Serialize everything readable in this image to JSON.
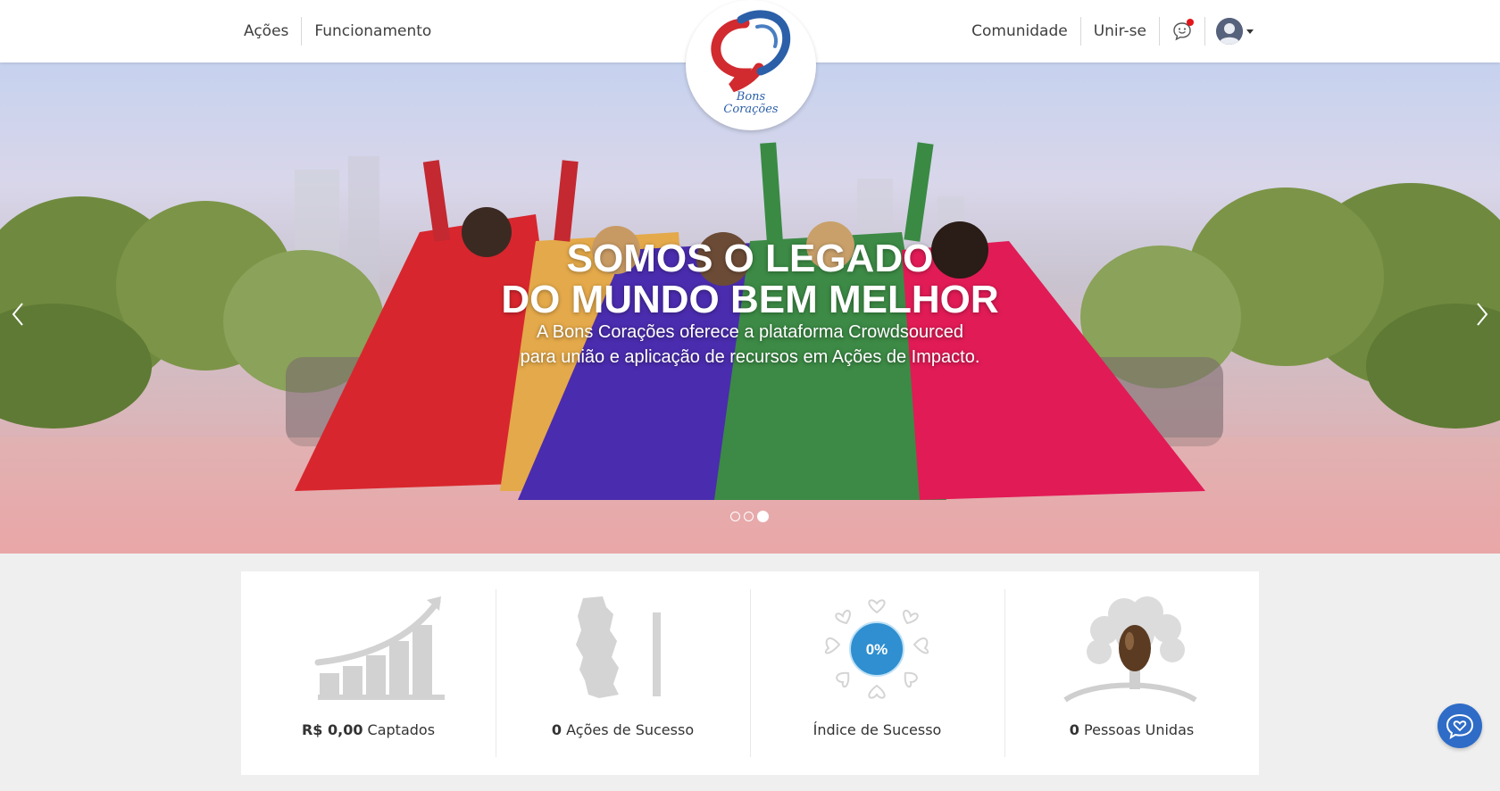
{
  "nav": {
    "left": [
      "Ações",
      "Funcionamento"
    ],
    "right": [
      "Comunidade",
      "Unir-se"
    ]
  },
  "logo": {
    "line1": "Bons",
    "line2": "Corações"
  },
  "hero": {
    "title_line1": "SOMOS O LEGADO",
    "title_line2": "DO MUNDO BEM MELHOR",
    "subtitle_line1": "A Bons Corações oferece a plataforma Crowdsourced",
    "subtitle_line2": "para união e aplicação de recursos em Ações de Impacto.",
    "slides_total": 3,
    "active_slide": 3
  },
  "stats": [
    {
      "value": "R$ 0,00",
      "label": "Captados",
      "icon": "growth-chart-icon"
    },
    {
      "value": "0",
      "label": "Ações de Sucesso",
      "icon": "map-icon"
    },
    {
      "value": "",
      "label": "Índice de Sucesso",
      "badge": "0%",
      "icon": "heart-wreath-icon"
    },
    {
      "value": "0",
      "label": "Pessoas Unidas",
      "icon": "tree-seed-icon"
    }
  ],
  "colors": {
    "accent_blue": "#2e6cc7",
    "logo_red": "#d12a2f",
    "logo_blue": "#2b5fa8",
    "notification": "#e4141b"
  }
}
